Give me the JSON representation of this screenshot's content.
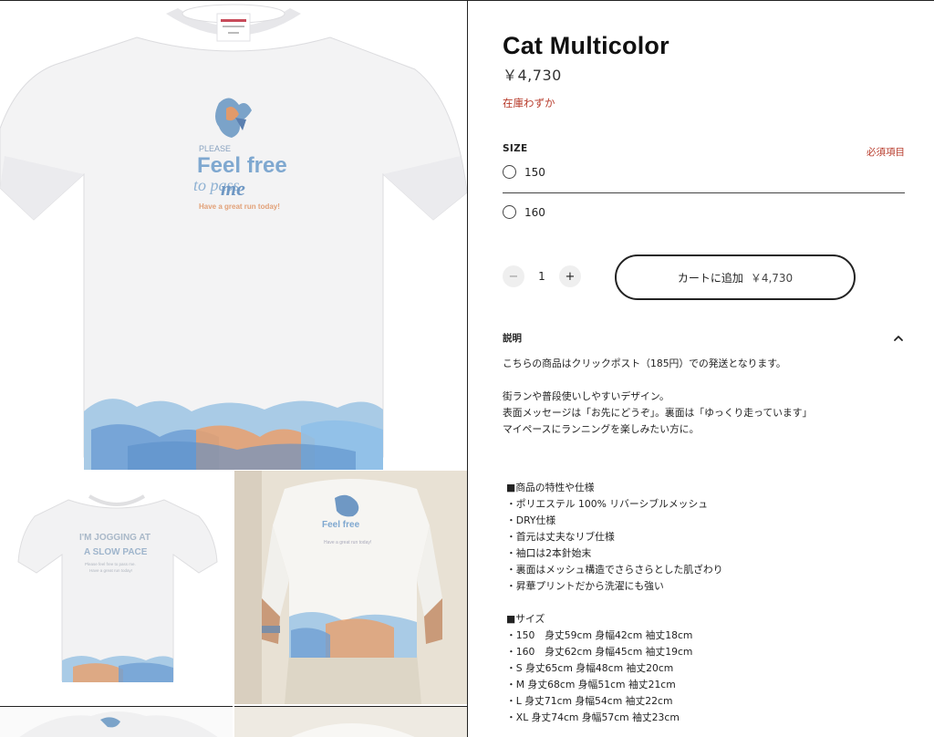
{
  "product": {
    "title": "Cat Multicolor",
    "price": "￥4,730",
    "stock": "在庫わずか"
  },
  "size": {
    "label": "SIZE",
    "required": "必須項目",
    "options": [
      "150",
      "160"
    ]
  },
  "quantity": {
    "minus": "−",
    "value": "1",
    "plus": "+"
  },
  "cart": {
    "label": "カートに追加",
    "price": "￥4,730"
  },
  "description": {
    "heading": "説明",
    "lines": {
      "shipping": "こちらの商品はクリックポスト（185円）での発送となります。",
      "intro1": "街ランや普段使いしやすいデザイン。",
      "intro2": "表面メッセージは「お先にどうぞ」。裏面は「ゆっくり走っています」",
      "intro3": "マイペースにランニングを楽しみたい方に。",
      "spec_head": "■商品の特性や仕様",
      "spec1": "・ポリエステル 100% リバーシブルメッシュ",
      "spec2": "・DRY仕様",
      "spec3": "・首元は丈夫なリブ仕様",
      "spec4": "・袖口は2本針始末",
      "spec5": "・裏面はメッシュ構造でさらさらとした肌ざわり",
      "spec6": "・昇華プリントだから洗濯にも強い",
      "size_head": "■サイズ",
      "size1": "・150　身丈59cm 身幅42cm 袖丈18cm",
      "size2": "・160　身丈62cm 身幅45cm 袖丈19cm",
      "size3": "・S 身丈65cm 身幅48cm 袖丈20cm",
      "size4": "・M 身丈68cm 身幅51cm 袖丈21cm",
      "size5": "・L 身丈71cm 身幅54cm 袖丈22cm",
      "size6": "・XL 身丈74cm 身幅57cm 袖丈23cm"
    }
  },
  "images": {
    "front_print": [
      "PLEASE",
      "Feel free",
      "to pass",
      "me",
      "Have a great run today!"
    ],
    "back_print": [
      "I'M JOGGING AT",
      "A SLOW PACE",
      "Please feel free to pass me.",
      "Have a great run today!"
    ]
  },
  "colors": {
    "accent_red": "#b73a2a",
    "text": "#1a1a1a",
    "print_blue": "#6fa7d6",
    "print_orange": "#e9a070"
  }
}
